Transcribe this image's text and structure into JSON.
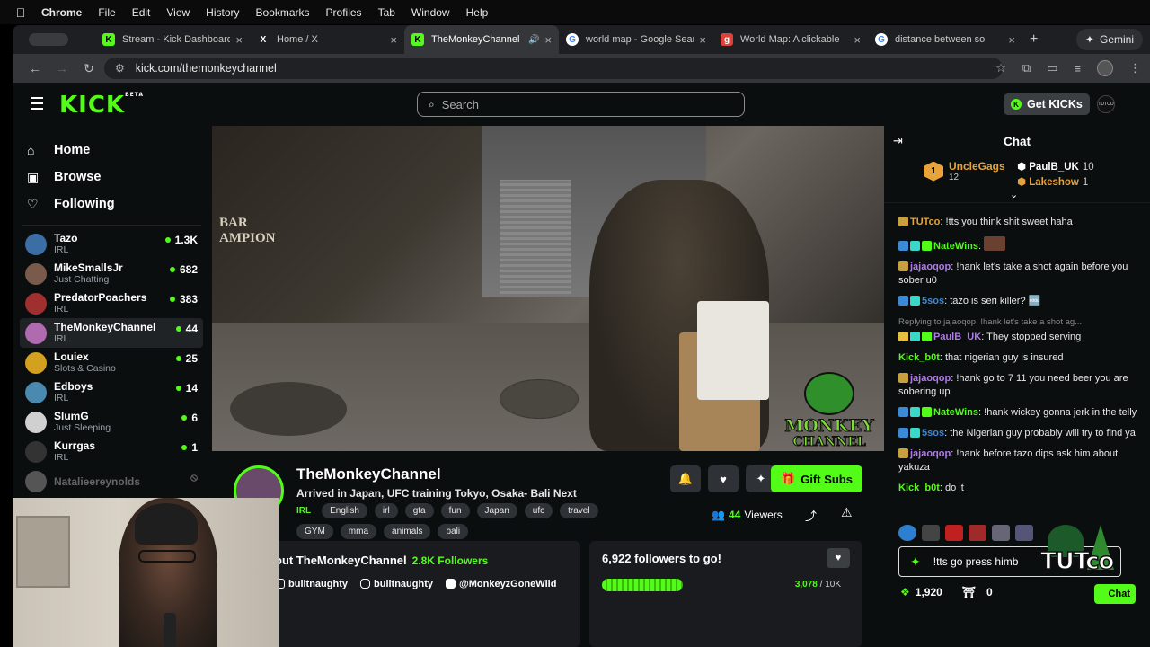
{
  "os_menu": {
    "apple": "",
    "items": [
      "Chrome",
      "File",
      "Edit",
      "View",
      "History",
      "Bookmarks",
      "Profiles",
      "Tab",
      "Window",
      "Help"
    ]
  },
  "tabs": [
    {
      "title": "Stream - Kick Dashboard",
      "favicon": "K",
      "favicon_color": "#53fc18",
      "active": false
    },
    {
      "title": "Home / X",
      "favicon": "X",
      "favicon_color": "#000000",
      "active": false
    },
    {
      "title": "TheMonkeyChannel",
      "favicon": "K",
      "favicon_color": "#53fc18",
      "active": true
    },
    {
      "title": "world map - Google Search",
      "favicon": "G",
      "favicon_color": "#4285f4",
      "active": false
    },
    {
      "title": "World Map: A clickable",
      "favicon": "g",
      "favicon_color": "#d9433b",
      "active": false
    },
    {
      "title": "distance between so",
      "favicon": "G",
      "favicon_color": "#4285f4",
      "active": false
    }
  ],
  "gemini_label": "Gemini",
  "url": "kick.com/themonkeychannel",
  "kick": {
    "logo": "KICK",
    "logo_badge": "BETA",
    "search_placeholder": "Search",
    "get_kicks": "Get KICKs",
    "user_avatar_text": "TUTCO",
    "accent": "#53fc18"
  },
  "sidebar": {
    "nav": [
      {
        "label": "Home",
        "icon": "home-icon"
      },
      {
        "label": "Browse",
        "icon": "browse-icon"
      },
      {
        "label": "Following",
        "icon": "heart-icon"
      }
    ],
    "channels": [
      {
        "name": "Tazo",
        "category": "IRL",
        "viewers": "1.3K",
        "live": true,
        "color": "#3a6ea5"
      },
      {
        "name": "MikeSmallsJr",
        "category": "Just Chatting",
        "viewers": "682",
        "live": true,
        "color": "#7a5a4a"
      },
      {
        "name": "PredatorPoachers",
        "category": "IRL",
        "viewers": "383",
        "live": true,
        "color": "#a03030"
      },
      {
        "name": "TheMonkeyChannel",
        "category": "IRL",
        "viewers": "44",
        "live": true,
        "color": "#b06ab0",
        "active": true
      },
      {
        "name": "Louiex",
        "category": "Slots & Casino",
        "viewers": "25",
        "live": true,
        "color": "#d4a020"
      },
      {
        "name": "Edboys",
        "category": "IRL",
        "viewers": "14",
        "live": true,
        "color": "#4a8ab0"
      },
      {
        "name": "SlumG",
        "category": "Just Sleeping",
        "viewers": "6",
        "live": true,
        "color": "#d0d0d0"
      },
      {
        "name": "Kurrgas",
        "category": "IRL",
        "viewers": "1",
        "live": true,
        "color": "#333333"
      },
      {
        "name": "Natalieereynolds",
        "category": "",
        "viewers": "",
        "live": false,
        "color": "#555555"
      }
    ]
  },
  "video": {
    "sign_text": "BAR\nAMPION",
    "overlay_logo_line1": "MONKEY",
    "overlay_logo_line2": "CHANNEL"
  },
  "stream": {
    "name": "TheMonkeyChannel",
    "title": "Arrived in Japan, UFC training Tokyo, Osaka- Bali Next",
    "category": "IRL",
    "tags": [
      "English",
      "irl",
      "gta",
      "fun",
      "Japan",
      "ufc",
      "travel",
      "GYM",
      "mma",
      "animals",
      "bali"
    ],
    "gift_label": "Gift Subs",
    "viewers_count": "44",
    "viewers_label": "Viewers"
  },
  "about": {
    "title": "out TheMonkeyChannel",
    "followers": "2.8K Followers",
    "socials": [
      "builtnaughty",
      "builtnaughty",
      "@MonkeyzGoneWild"
    ]
  },
  "goal": {
    "title": "6,922 followers to go!",
    "current": "3,078",
    "target": "/ 10K",
    "progress": 0.31
  },
  "chat": {
    "title": "Chat",
    "leaderboard": {
      "first": {
        "rank": "1",
        "name": "UncleGags",
        "count": "12"
      },
      "second": {
        "name": "PaulB_UK",
        "count": "10"
      },
      "third": {
        "name": "Lakeshow",
        "count": "1"
      }
    },
    "messages": [
      {
        "user": "TUTco",
        "color": "#e8a33a",
        "text": "!tts you think shit sweet haha",
        "badges": [
          "#c9a040"
        ]
      },
      {
        "user": "NateWins",
        "color": "#53fc18",
        "text": "",
        "badges": [
          "#3a8ad8",
          "#3ad8c8",
          "#53fc18"
        ],
        "emote": true
      },
      {
        "user": "jajaoqop",
        "color": "#b07ae8",
        "text": "!hank let's take a shot again before you sober u0",
        "badges": [
          "#c9a040"
        ]
      },
      {
        "user": "5sos",
        "color": "#3a8ad8",
        "text": "tazo is seri killer? 🆒",
        "badges": [
          "#3a8ad8",
          "#3ad8c8"
        ]
      },
      {
        "reply": "Replying to jajaoqop: !hank let's take a shot ag..."
      },
      {
        "user": "PaulB_UK",
        "color": "#b07ae8",
        "text": "They stopped serving",
        "badges": [
          "#e8c040",
          "#3ad8c8",
          "#53fc18"
        ]
      },
      {
        "user": "Kick_b0t",
        "color": "#53fc18",
        "text": "that nigerian guy is insured",
        "badges": []
      },
      {
        "user": "jajaoqop",
        "color": "#b07ae8",
        "text": "!hank go to 7 11 you need beer you are sobering up",
        "badges": [
          "#c9a040"
        ]
      },
      {
        "user": "NateWins",
        "color": "#53fc18",
        "text": "!hank wickey gonna jerk in the telly",
        "badges": [
          "#3a8ad8",
          "#3ad8c8",
          "#53fc18"
        ]
      },
      {
        "user": "5sos",
        "color": "#3a8ad8",
        "text": "the Nigerian guy probably will try to find ya",
        "badges": [
          "#3a8ad8",
          "#3ad8c8"
        ]
      },
      {
        "user": "jajaoqop",
        "color": "#b07ae8",
        "text": "!hank before tazo dips ask him about yakuza",
        "badges": [
          "#c9a040"
        ]
      },
      {
        "user": "Kick_b0t",
        "color": "#53fc18",
        "text": "do it",
        "badges": []
      }
    ],
    "input_value": "!tts go press himb",
    "kicks_balance": "1,920",
    "points": "0",
    "send_label": "Chat",
    "overlay_text": "TUTco"
  }
}
